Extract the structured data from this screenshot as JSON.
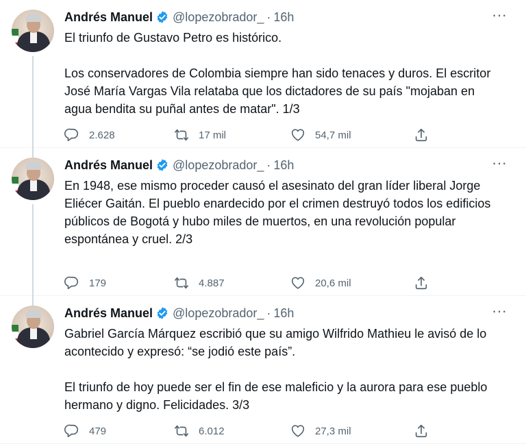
{
  "tweets": [
    {
      "name": "Andrés Manuel",
      "handle": "@lopezobrador_",
      "separator": "·",
      "time": "16h",
      "text": "El triunfo de Gustavo Petro es histórico.\n\nLos conservadores de Colombia siempre han sido tenaces y duros. El escritor José María Vargas Vila relataba que los dictadores de su país \"mojaban en agua bendita su puñal antes de matar\". 1/3",
      "replies": "2.628",
      "retweets": "17 mil",
      "likes": "54,7 mil"
    },
    {
      "name": "Andrés Manuel",
      "handle": "@lopezobrador_",
      "separator": "·",
      "time": "16h",
      "text": "En 1948, ese mismo proceder causó el asesinato del gran líder liberal Jorge Eliécer Gaitán. El pueblo enardecido por el crimen destruyó todos los edificios públicos de Bogotá y hubo miles de muertos, en una revolución popular espontánea y cruel. 2/3",
      "replies": "179",
      "retweets": "4.887",
      "likes": "20,6 mil"
    },
    {
      "name": "Andrés Manuel",
      "handle": "@lopezobrador_",
      "separator": "·",
      "time": "16h",
      "text": "Gabriel García Márquez escribió que su amigo Wilfrido Mathieu le avisó de lo acontecido y expresó: “se jodió este país”.\n\nEl triunfo de hoy puede ser el fin de ese maleficio y la aurora para ese pueblo hermano y digno. Felicidades. 3/3",
      "replies": "479",
      "retweets": "6.012",
      "likes": "27,3 mil"
    }
  ],
  "more_glyph": "···",
  "icons": {
    "verified": "verified-badge-icon",
    "reply": "reply-bubble-icon",
    "retweet": "retweet-icon",
    "like": "heart-icon",
    "share": "share-upload-icon"
  },
  "colors": {
    "verified": "#1d9bf0",
    "text": "#0f1419",
    "secondary": "#536471",
    "thread_line": "#cfd9de"
  }
}
